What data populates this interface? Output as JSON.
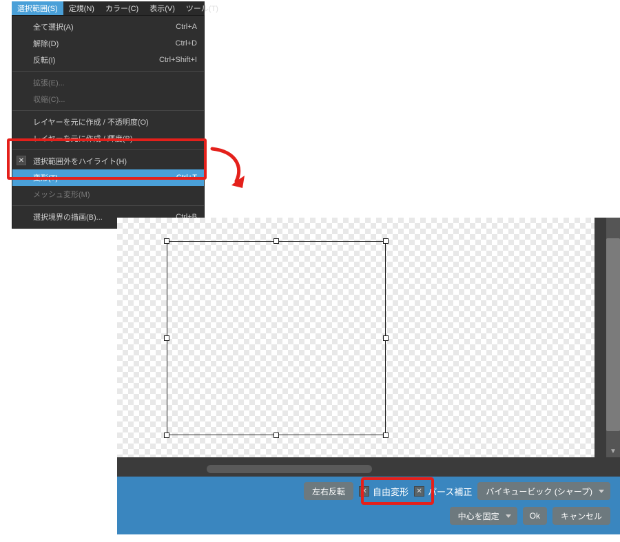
{
  "menubar": {
    "items": [
      {
        "label": "選択範囲(S)",
        "active": true
      },
      {
        "label": "定規(N)"
      },
      {
        "label": "カラー(C)"
      },
      {
        "label": "表示(V)"
      },
      {
        "label": "ツール(T)"
      }
    ]
  },
  "dropdown": [
    {
      "type": "item",
      "label": "全て選択(A)",
      "shortcut": "Ctrl+A"
    },
    {
      "type": "item",
      "label": "解除(D)",
      "shortcut": "Ctrl+D"
    },
    {
      "type": "item",
      "label": "反転(I)",
      "shortcut": "Ctrl+Shift+I"
    },
    {
      "type": "sep"
    },
    {
      "type": "item",
      "label": "拡張(E)...",
      "dim": true
    },
    {
      "type": "item",
      "label": "収縮(C)...",
      "dim": true
    },
    {
      "type": "sep"
    },
    {
      "type": "item",
      "label": "レイヤーを元に作成 / 不透明度(O)"
    },
    {
      "type": "item",
      "label": "レイヤーを元に作成 / 輝度(B)"
    },
    {
      "type": "sep"
    },
    {
      "type": "item",
      "label": "選択範囲外をハイライト(H)",
      "check": true
    },
    {
      "type": "item",
      "label": "変形(T)",
      "shortcut": "Ctrl+T",
      "highlight": true
    },
    {
      "type": "item",
      "label": "メッシュ変形(M)",
      "dim": true
    },
    {
      "type": "sep"
    },
    {
      "type": "item",
      "label": "選択境界の描画(B)...",
      "shortcut": "Ctrl+B"
    }
  ],
  "toolbar": {
    "flip": "左右反転",
    "freeTransform": "自由変形",
    "perspective": "パース補正",
    "interpolation": "バイキュービック (シャープ)",
    "fixCenter": "中心を固定",
    "ok": "Ok",
    "cancel": "キャンセル"
  }
}
